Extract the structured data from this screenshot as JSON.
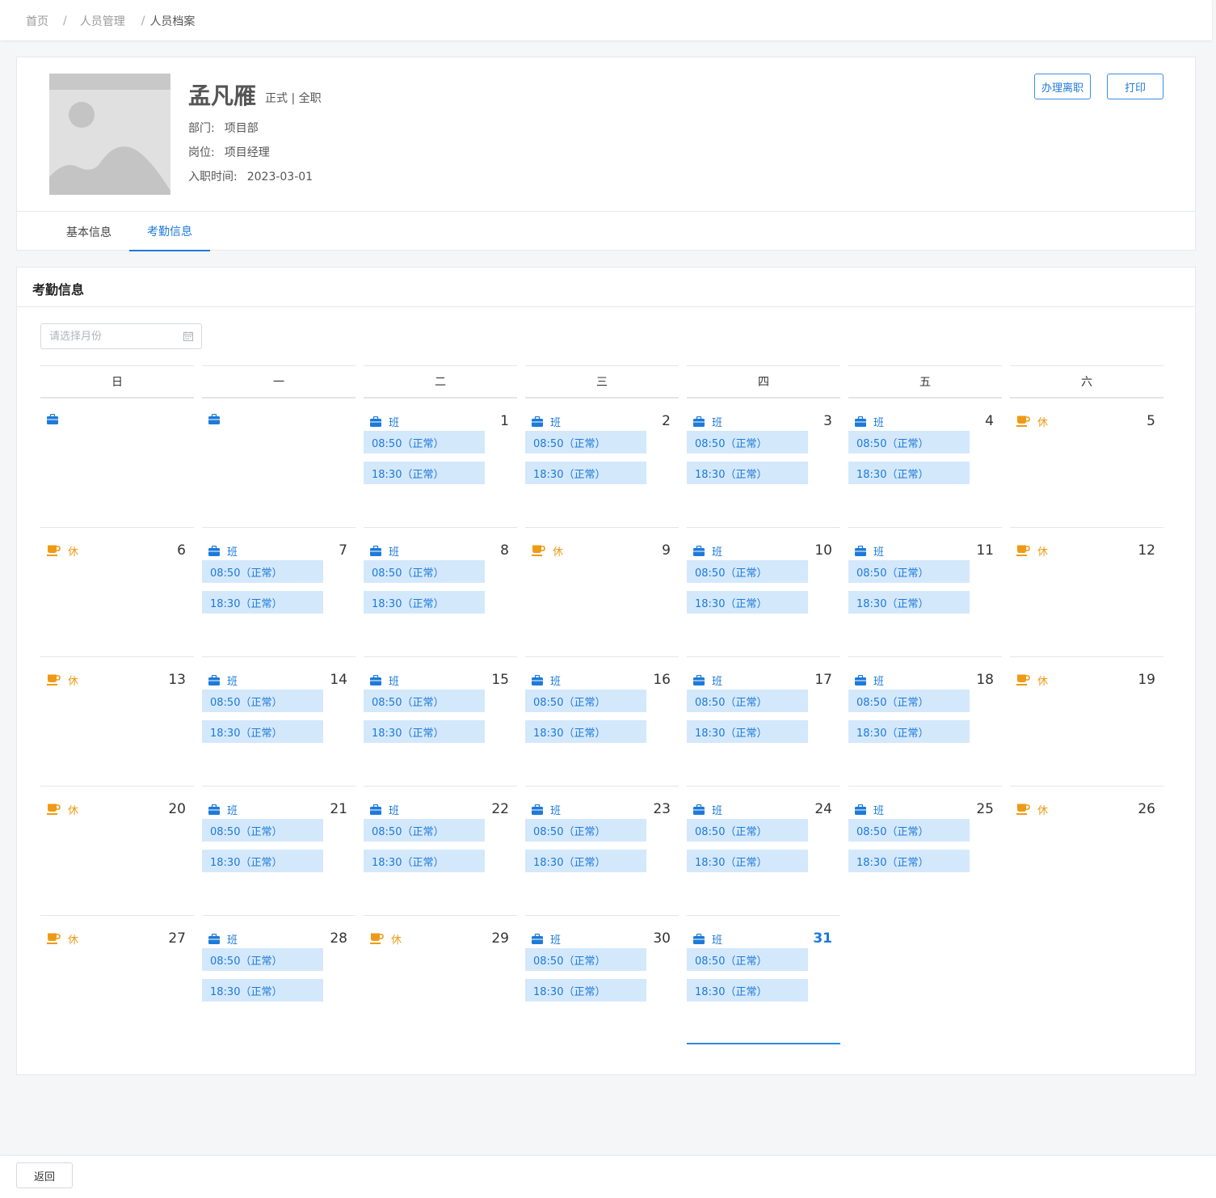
{
  "breadcrumb": {
    "home": "首页",
    "section": "人员管理",
    "current": "人员档案",
    "separator": "/"
  },
  "profile": {
    "name": "孟凡雁",
    "tags": "正式 | 全职",
    "department_label": "部门:",
    "department": "项目部",
    "position_label": "岗位:",
    "position": "项目经理",
    "hire_date_label": "入职时间:",
    "hire_date": "2023-03-01",
    "resign_button": "办理离职",
    "print_button": "打印"
  },
  "tabs": [
    {
      "label": "基本信息",
      "active": false
    },
    {
      "label": "考勤信息",
      "active": true
    }
  ],
  "attendance": {
    "title": "考勤信息",
    "month_placeholder": "请选择月份",
    "weekdays": [
      "日",
      "一",
      "二",
      "三",
      "四",
      "五",
      "六"
    ],
    "work_label": "班",
    "rest_label": "休",
    "clock_in": "08:50（正常）",
    "clock_out": "18:30（正常）",
    "today": 31,
    "days": [
      {
        "day": null,
        "type": "work-icon-only"
      },
      {
        "day": null,
        "type": "work-icon-only"
      },
      {
        "day": 1,
        "type": "work"
      },
      {
        "day": 2,
        "type": "work"
      },
      {
        "day": 3,
        "type": "work"
      },
      {
        "day": 4,
        "type": "work"
      },
      {
        "day": 5,
        "type": "rest"
      },
      {
        "day": 6,
        "type": "rest"
      },
      {
        "day": 7,
        "type": "work"
      },
      {
        "day": 8,
        "type": "work"
      },
      {
        "day": 9,
        "type": "rest"
      },
      {
        "day": 10,
        "type": "work"
      },
      {
        "day": 11,
        "type": "work"
      },
      {
        "day": 12,
        "type": "rest"
      },
      {
        "day": 13,
        "type": "rest"
      },
      {
        "day": 14,
        "type": "work"
      },
      {
        "day": 15,
        "type": "work"
      },
      {
        "day": 16,
        "type": "work"
      },
      {
        "day": 17,
        "type": "work"
      },
      {
        "day": 18,
        "type": "work"
      },
      {
        "day": 19,
        "type": "rest"
      },
      {
        "day": 20,
        "type": "rest"
      },
      {
        "day": 21,
        "type": "work"
      },
      {
        "day": 22,
        "type": "work"
      },
      {
        "day": 23,
        "type": "work"
      },
      {
        "day": 24,
        "type": "work"
      },
      {
        "day": 25,
        "type": "work"
      },
      {
        "day": 26,
        "type": "rest"
      },
      {
        "day": 27,
        "type": "rest"
      },
      {
        "day": 28,
        "type": "work"
      },
      {
        "day": 29,
        "type": "rest"
      },
      {
        "day": 30,
        "type": "work"
      },
      {
        "day": 31,
        "type": "work"
      }
    ]
  },
  "colors": {
    "accent": "#1d7ad9",
    "rest": "#ef9a16",
    "punch_bg": "#d4e8fc"
  },
  "footer": {
    "back_button": "返回"
  }
}
